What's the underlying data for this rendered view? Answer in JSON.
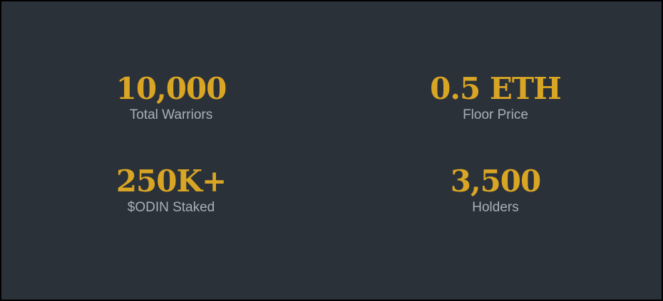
{
  "stats": [
    {
      "value": "10,000",
      "label": "Total Warriors"
    },
    {
      "value": "0.5 ETH",
      "label": "Floor Price"
    },
    {
      "value": "250K+",
      "label": "$ODIN Staked"
    },
    {
      "value": "3,500",
      "label": "Holders"
    }
  ],
  "colors": {
    "background": "#2b3139",
    "frame": "#000000",
    "accent": "#d9a524",
    "label": "#a7b0ba"
  }
}
